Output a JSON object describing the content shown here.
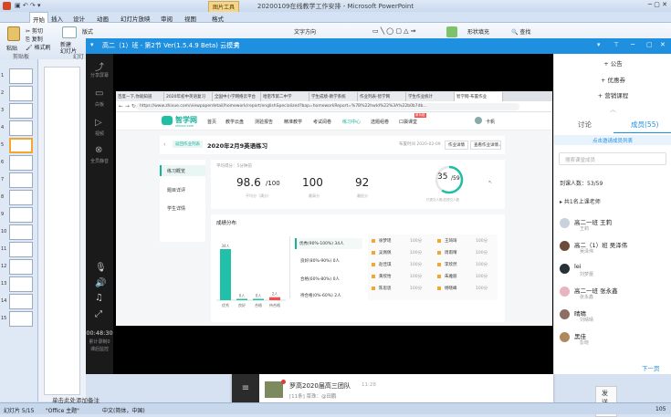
{
  "ppt": {
    "title": "20200109在线教学工作安排 - Microsoft PowerPoint",
    "tool_tab": "图片工具",
    "tabs": [
      "开始",
      "插入",
      "设计",
      "动画",
      "幻灯片放映",
      "审阅",
      "视图",
      "格式"
    ],
    "ribbon": {
      "paste": "粘贴",
      "cut": "剪切",
      "copy": "复制",
      "format_painter": "格式刷",
      "new_slide": "新建\n幻灯片",
      "layout": "版式",
      "clipboard_group": "剪贴板",
      "slides_group": "幻灯",
      "text_direction": "文字方向",
      "shape_fill": "形状填充",
      "find": "查找"
    },
    "slide_numbers": [
      "1",
      "2",
      "3",
      "4",
      "5",
      "6",
      "7",
      "8",
      "9",
      "10",
      "11",
      "12",
      "13",
      "14",
      "15"
    ],
    "notes_hint": "单击此处添加备注",
    "status": {
      "slide": "幻灯片 5/15",
      "theme": "\"Office 主题\"",
      "lang": "中文(简体，中国)",
      "zoom": "105"
    }
  },
  "meeting": {
    "title": "高二（1）班 - 第2节  Ver(1.5.4.9 Beta)  云模式",
    "left_buttons": [
      "分享屏幕",
      "白板",
      "视频",
      "全员静音"
    ],
    "timer": "00:48:30",
    "timer_sub1": "累计录制0",
    "timer_sub2": "课后监控"
  },
  "browser": {
    "tabs": [
      "百度一下,你就知道",
      "2020年初中英语复习",
      "全国中小学网络云平台",
      "哈密市第二中学",
      "学生成绩-教学系统",
      "作业列表-智学网",
      "学生作业统计",
      "智学网-布置作业"
    ],
    "url": "https://www.zhixue.com/viewpaperdetail/homework/report/englishSpecialized?bap=homeworkReport=%7B%22hwId%22%3A%22b0b7db...",
    "logo": "智学网",
    "logo_sub": "zhixue.com",
    "nav": [
      "首页",
      "教学云盘",
      "测验报告",
      "精准教学",
      "考试阅卷",
      "练习中心",
      "选题组卷",
      "口袋课堂"
    ],
    "nav_active": "练习中心",
    "nav_badge": "新功能",
    "user": "卡帆",
    "back_label": "返回作业列表",
    "hw_title": "2020年2月9英语练习",
    "hw_meta": "布置时间 2020-02-09",
    "hw_btn1": "作业详情",
    "hw_btn2": "查看作业详情 / 批阅",
    "side": [
      "练习概览",
      "题目详评",
      "学生详情"
    ],
    "score_label": "平均得分：5分钟前",
    "avg": "98.6",
    "avg_total": "/100",
    "avg_sub": "平均分（满分）",
    "highest": "100",
    "highest_sub": "最高分",
    "lowest": "92",
    "lowest_sub": "最低分",
    "submitted": "35",
    "submitted_total": "/59",
    "submitted_sub": "已提交人数/应提交人数",
    "dist_title": "成绩分布",
    "bars": [
      {
        "label": "优秀",
        "count": "34人",
        "value": 34
      },
      {
        "label": "良好",
        "count": "0人",
        "value": 0
      },
      {
        "label": "合格",
        "count": "0人",
        "value": 0
      },
      {
        "label": "待合格",
        "count": "2人",
        "value": 2
      }
    ],
    "levels": [
      "优秀(90%-100%) 34人",
      "良好(80%-90%) 0人",
      "合格(60%-80%) 0人",
      "待合格(0%-60%) 2人"
    ],
    "students": [
      [
        "徐梦瑶",
        "100分"
      ],
      [
        "王琦琦",
        "100分"
      ],
      [
        "吴佩佩",
        "100分"
      ],
      [
        "周雨晴",
        "100分"
      ],
      [
        "赵佳琪",
        "100分"
      ],
      [
        "李欣然",
        "100分"
      ],
      [
        "黄欣怡",
        "100分"
      ],
      [
        "朱雅丽",
        "100分"
      ],
      [
        "陈思思",
        "100分"
      ],
      [
        "杨晓峰",
        "100分"
      ]
    ]
  },
  "panel": {
    "items": [
      "+ 公告",
      "+ 优惠券",
      "+ 营销课程"
    ],
    "tab_discuss": "讨论",
    "tab_members": "成员(55)",
    "invite": "点击邀请成员列表",
    "search": "搜索课堂成员",
    "arrived": "到课人数：53/59",
    "teachers": "共1名上课老师",
    "members": [
      {
        "name": "高二一班 王莉",
        "sub": "王莉",
        "color": "#c9d2dc"
      },
      {
        "name": "高二（1）班 吴泽伟",
        "sub": "吴泽伟",
        "color": "#6b4b3a"
      },
      {
        "name": "lei",
        "sub": "刘梦蕾",
        "color": "#263238"
      },
      {
        "name": "高二一班 张永鑫",
        "sub": "张永鑫",
        "color": "#e8b4c0"
      },
      {
        "name": "晴晴",
        "sub": "刘晴晴",
        "color": "#8d6e63"
      },
      {
        "name": "黑佳",
        "sub": "彭晓",
        "color": "#b0895a"
      }
    ],
    "next": "下一页"
  },
  "notification": {
    "group": "罗高2020届高三团队",
    "time": "11:28",
    "msg": "[11条] 菜珠：@田鹏",
    "send": "发送(S)"
  },
  "colors": {
    "accent": "#1f8fe0",
    "chart_green": "#21c0a8",
    "chart_red": "#f05050"
  }
}
